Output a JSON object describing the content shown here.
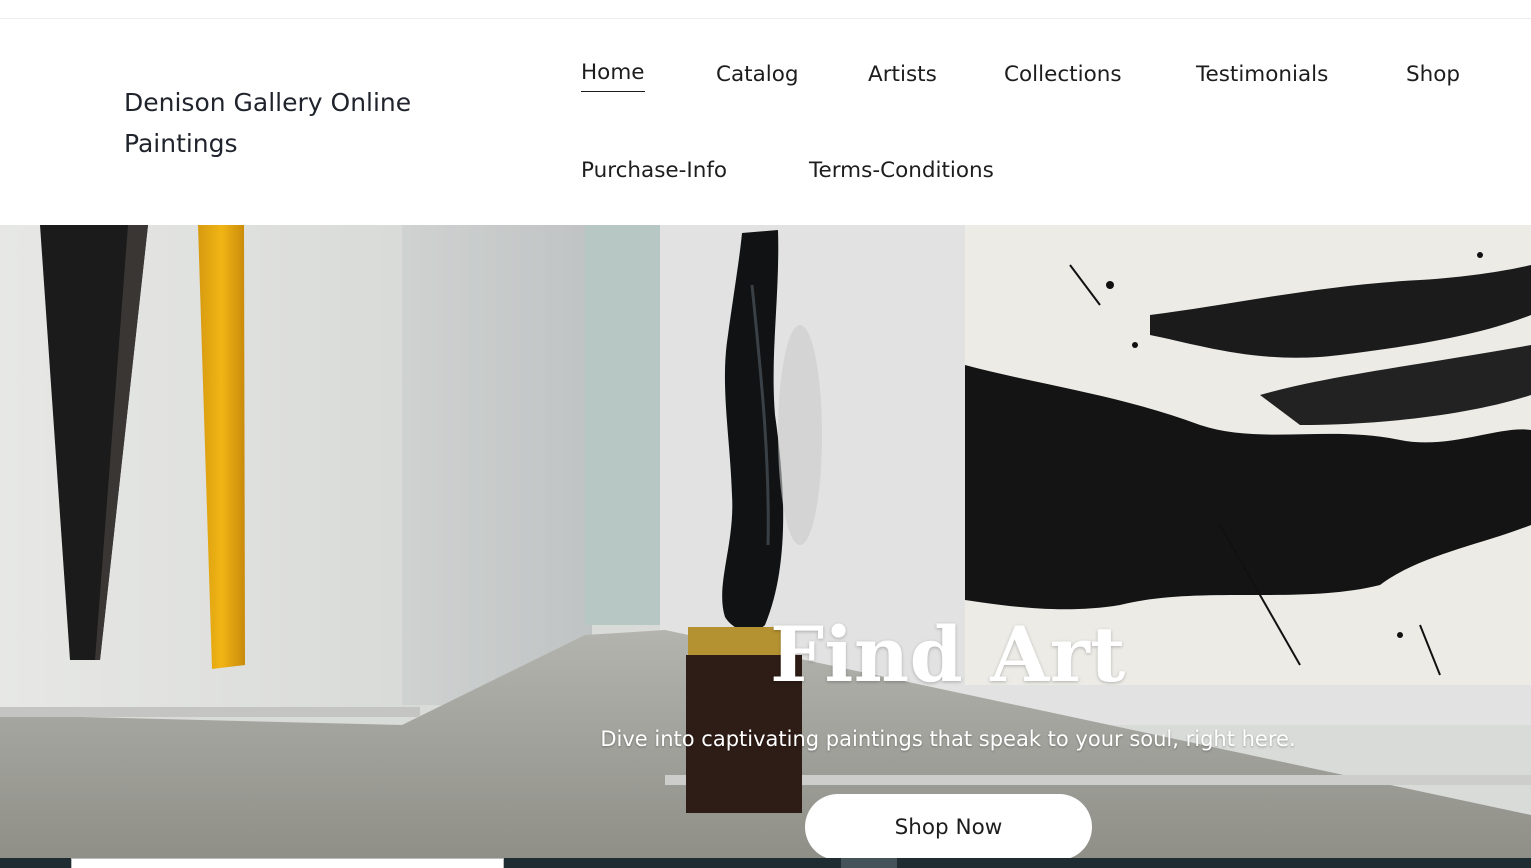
{
  "site": {
    "title_line1": "Denison Gallery Online",
    "title_line2": "Paintings"
  },
  "nav": {
    "items": [
      {
        "label": "Home",
        "active": true
      },
      {
        "label": "Catalog"
      },
      {
        "label": "Artists"
      },
      {
        "label": "Collections"
      },
      {
        "label": "Testimonials"
      },
      {
        "label": "Shop"
      },
      {
        "label": "Purchase-Info"
      },
      {
        "label": "Terms-Conditions"
      }
    ]
  },
  "hero": {
    "title": "Find Art",
    "subtitle": "Dive into captivating paintings that speak to your soul, right here.",
    "cta_label": "Shop Now"
  },
  "colors": {
    "text": "#1d1d1d",
    "brand_text": "#1f232b",
    "footer_bg": "#1f2d33",
    "cta_bg": "#ffffff"
  }
}
